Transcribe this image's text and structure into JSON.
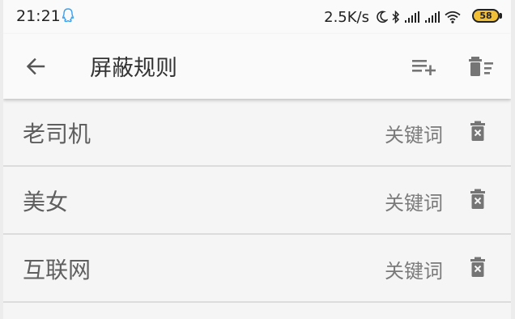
{
  "status_bar": {
    "time": "21:21",
    "net_speed": "2.5K/s",
    "battery": "58",
    "icons": [
      "qq-icon",
      "moon-icon",
      "bluetooth-icon",
      "signal-icon",
      "signal-icon",
      "wifi-icon",
      "battery-icon"
    ]
  },
  "app_bar": {
    "title": "屏蔽规则",
    "icons": [
      "back-arrow-icon",
      "playlist-add-icon",
      "delete-sweep-icon"
    ]
  },
  "rules": [
    {
      "label": "老司机",
      "type": "关键词"
    },
    {
      "label": "美女",
      "type": "关键词"
    },
    {
      "label": "互联网",
      "type": "关键词"
    }
  ],
  "colors": {
    "background": "#f5f5f5",
    "app_bar": "#fafafa",
    "divider": "#dcdcdc",
    "icon_gray": "#757575",
    "qq_blue": "#3aa0f0",
    "battery_yellow": "#f2c037"
  }
}
